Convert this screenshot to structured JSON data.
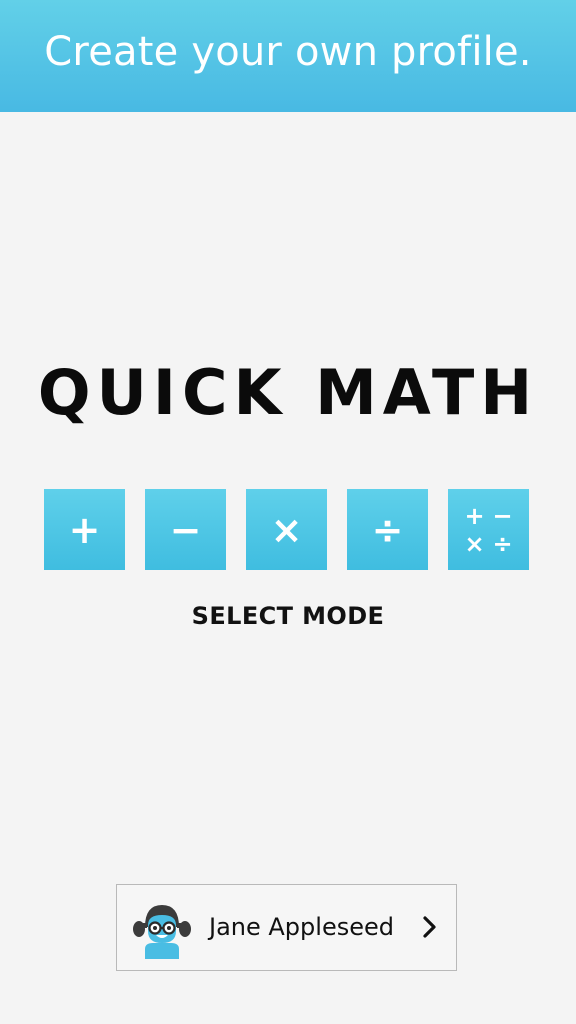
{
  "banner": {
    "text": "Create your own profile."
  },
  "app": {
    "title": "QUICK MATH"
  },
  "modes": {
    "items": [
      {
        "symbol": "+"
      },
      {
        "symbol": "−"
      },
      {
        "symbol": "×"
      },
      {
        "symbol": "÷"
      },
      {
        "symbols": [
          "+",
          "−",
          "×",
          "÷"
        ]
      }
    ],
    "caption": "SELECT MODE"
  },
  "profile": {
    "name": "Jane Appleseed",
    "avatar_icon": "girl-with-glasses-avatar-icon",
    "chevron_icon": "chevron-right-icon"
  },
  "colors": {
    "accent": "#4ec4e4",
    "text": "#111111",
    "background": "#f4f4f4"
  }
}
